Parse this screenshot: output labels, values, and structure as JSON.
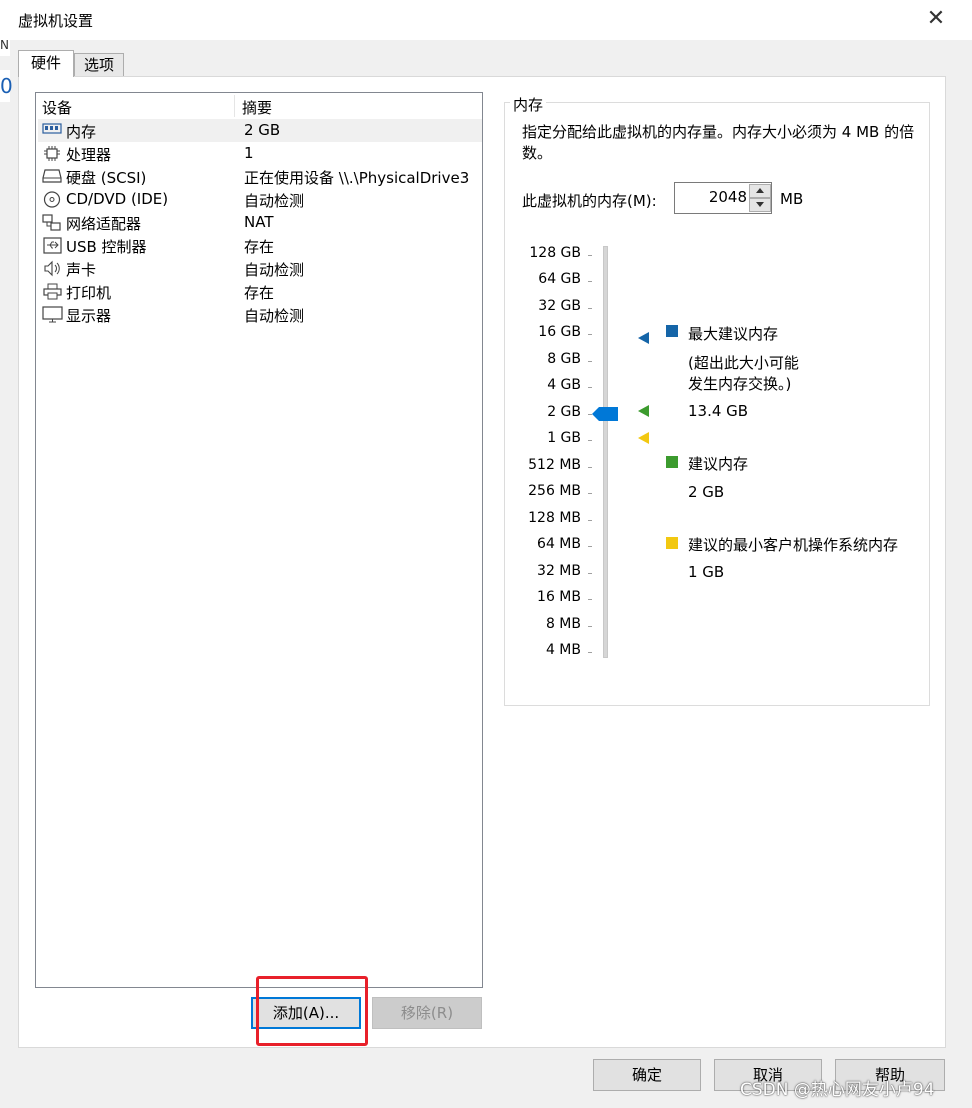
{
  "window": {
    "title": "虚拟机设置",
    "close_glyph": "✕"
  },
  "background_fragments": {
    "left_top": "0",
    "left_mid": "N"
  },
  "tabs": [
    {
      "label": "硬件"
    },
    {
      "label": "选项"
    }
  ],
  "device_list": {
    "headers": {
      "device": "设备",
      "summary": "摘要"
    },
    "rows": [
      {
        "icon": "memory-icon",
        "name": "内存",
        "summary": "2 GB",
        "selected": true
      },
      {
        "icon": "processor-icon",
        "name": "处理器",
        "summary": "1"
      },
      {
        "icon": "hard-disk-icon",
        "name": "硬盘 (SCSI)",
        "summary": "正在使用设备 \\\\.\\PhysicalDrive3"
      },
      {
        "icon": "cd-dvd-icon",
        "name": "CD/DVD (IDE)",
        "summary": "自动检测"
      },
      {
        "icon": "network-adapter-icon",
        "name": "网络适配器",
        "summary": "NAT"
      },
      {
        "icon": "usb-icon",
        "name": "USB 控制器",
        "summary": "存在"
      },
      {
        "icon": "sound-card-icon",
        "name": "声卡",
        "summary": "自动检测"
      },
      {
        "icon": "printer-icon",
        "name": "打印机",
        "summary": "存在"
      },
      {
        "icon": "display-icon",
        "name": "显示器",
        "summary": "自动检测"
      }
    ],
    "buttons": {
      "add": "添加(A)...",
      "remove": "移除(R)"
    }
  },
  "memory": {
    "group_title": "内存",
    "description": "指定分配给此虚拟机的内存量。内存大小必须为 4 MB 的倍数。",
    "field_label": "此虚拟机的内存(M):",
    "value": "2048",
    "unit": "MB",
    "scale_ticks": [
      "128 GB",
      "64 GB",
      "32 GB",
      "16 GB",
      "8 GB",
      "4 GB",
      "2 GB",
      "1 GB",
      "512 MB",
      "256 MB",
      "128 MB",
      "64 MB",
      "32 MB",
      "16 MB",
      "8 MB",
      "4 MB"
    ],
    "current_tick_index": 6,
    "legend": {
      "max": {
        "label": "最大建议内存",
        "note_line1": "(超出此大小可能",
        "note_line2": "发生内存交换。)",
        "value": "13.4 GB",
        "color": "#1565a8"
      },
      "recommended": {
        "label": "建议内存",
        "value": "2 GB",
        "color": "#3c9b2e"
      },
      "min_guest": {
        "label": "建议的最小客户机操作系统内存",
        "value": "1 GB",
        "color": "#f2c811"
      }
    },
    "thumb_color": "#0078d7"
  },
  "footer": {
    "ok": "确定",
    "cancel": "取消",
    "help": "帮助"
  },
  "watermark": "CSDN @热心网友小卢94"
}
